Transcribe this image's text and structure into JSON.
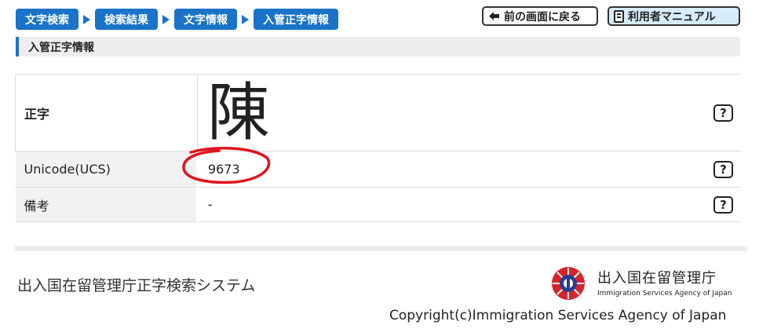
{
  "breadcrumb": {
    "items": [
      "文字検索",
      "検索結果",
      "文字情報",
      "入管正字情報"
    ]
  },
  "toolbar": {
    "back_label": "前の画面に戻る",
    "manual_label": "利用者マニュアル"
  },
  "section": {
    "title": "入管正字情報"
  },
  "info": {
    "rows": [
      {
        "label": "正字",
        "value": "陳"
      },
      {
        "label": "Unicode(UCS)",
        "value": "9673"
      },
      {
        "label": "備考",
        "value": "-"
      }
    ],
    "help_symbol": "?"
  },
  "footer": {
    "system_name": "出入国在留管理庁正字検索システム",
    "agency_name_ja": "出入国在留管理庁",
    "agency_name_en": "Immigration Services Agency of Japan",
    "copyright": "Copyright(c)Immigration Services Agency of Japan"
  },
  "colors": {
    "accent": "#1a73c9",
    "annotation": "#e0141e",
    "logo_red": "#d8232a"
  }
}
